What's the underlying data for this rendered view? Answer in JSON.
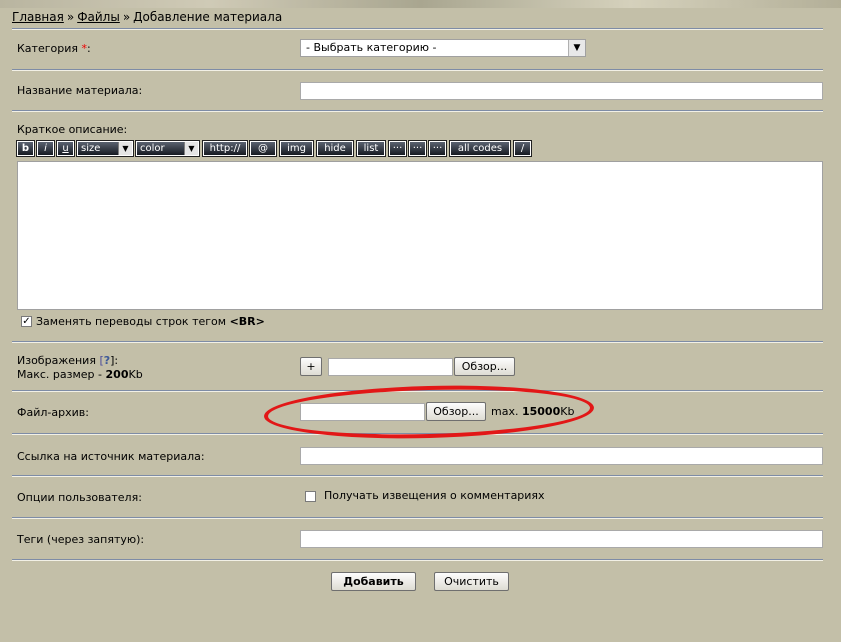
{
  "breadcrumb": {
    "home": "Главная",
    "sep1": "»",
    "files": "Файлы",
    "sep2": "»",
    "current": "Добавление материала"
  },
  "category": {
    "label": "Категория",
    "required_mark": "*",
    "colon": ":",
    "selected": "- Выбрать категорию -"
  },
  "title_field": {
    "label": "Название материала:",
    "value": ""
  },
  "description": {
    "label": "Краткое описание:",
    "value": "",
    "toolbar": {
      "bold": "b",
      "italic": "i",
      "underline": "u",
      "size": "size",
      "color": "color",
      "link": "http://",
      "email": "@",
      "image": "img",
      "hide": "hide",
      "list": "list",
      "more1": "···",
      "more2": "···",
      "more3": "···",
      "all_codes": "all codes",
      "close_tags": "/"
    },
    "replace_br": {
      "checked": true,
      "text": "Заменять переводы строк тегом",
      "tag": "<BR>"
    }
  },
  "images": {
    "label": "Изображения",
    "help_open": "[",
    "help": "?",
    "help_close": "]:",
    "max_label": "Макс. размер -",
    "max_value": "200",
    "max_unit": "Kb",
    "add_button": "+",
    "browse_button": "Обзор..."
  },
  "archive": {
    "label": "Файл-архив:",
    "browse_button": "Обзор...",
    "max_label": "max.",
    "max_value": "15000",
    "max_unit": "Kb"
  },
  "source_link": {
    "label": "Ссылка на источник материала:",
    "value": ""
  },
  "user_options": {
    "label": "Опции пользователя:",
    "notify_checked": false,
    "notify_text": "Получать извещения о комментариях"
  },
  "tags": {
    "label": "Теги (через запятую):",
    "value": ""
  },
  "actions": {
    "submit": "Добавить",
    "reset": "Очистить"
  },
  "colors": {
    "background": "#c3bfa8",
    "annotation_circle": "#e21717",
    "toolbar_button": "#1f242c"
  },
  "icons": {
    "select_arrow": "chevron-down-icon",
    "checkbox": "check-icon"
  }
}
